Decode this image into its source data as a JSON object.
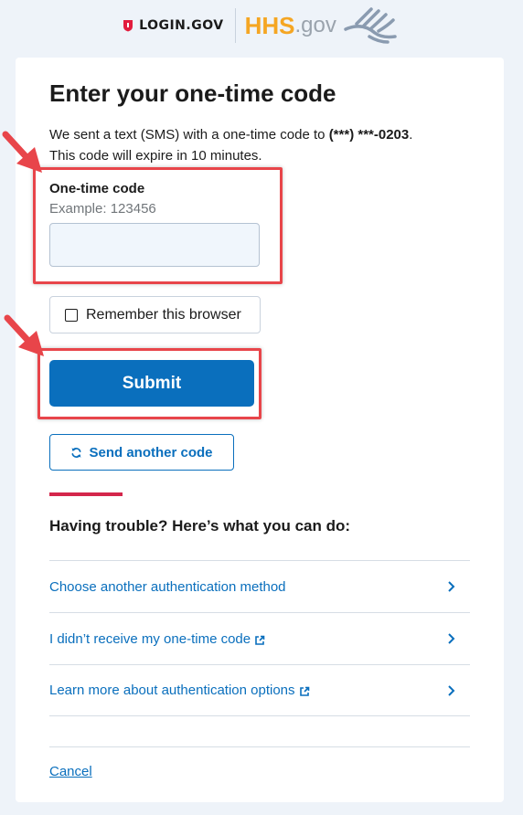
{
  "header": {
    "login_logo_text": "LOGIN.GOV",
    "hhs_text": "HHS",
    "gov_text": ".gov"
  },
  "page": {
    "title": "Enter your one-time code",
    "intro_prefix": "We sent a text (SMS) with a one-time code to ",
    "phone_masked": "(***) ***-0203",
    "intro_suffix": ".",
    "intro_line2": "This code will expire in 10 minutes."
  },
  "form": {
    "code_label": "One-time code",
    "code_hint": "Example: 123456",
    "code_value": "",
    "remember_label": "Remember this browser",
    "remember_checked": false,
    "submit_label": "Submit",
    "send_another_label": "Send another code"
  },
  "trouble": {
    "heading": "Having trouble? Here’s what you can do:",
    "options": [
      {
        "label": "Choose another authentication method",
        "external": false
      },
      {
        "label": "I didn’t receive my one-time code",
        "external": true
      },
      {
        "label": "Learn more about authentication options",
        "external": true
      }
    ]
  },
  "footer": {
    "cancel_label": "Cancel"
  },
  "colors": {
    "page_background": "#eef3f9",
    "primary_blue": "#0a6fbd",
    "accent_red": "#d4264b",
    "annotation_red": "#e8454a",
    "hhs_gold": "#f5a623"
  },
  "icons": {
    "login_logo": "shield-icon",
    "hhs_logo": "eagle-icon",
    "send_code": "refresh-icon",
    "external": "external-link-icon",
    "chevron": "chevron-right-icon",
    "annotation": "arrow-icon"
  }
}
